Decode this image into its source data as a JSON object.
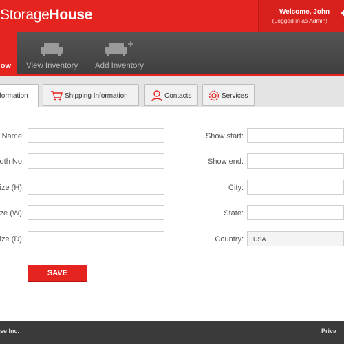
{
  "header": {
    "logo_part1": "Storage",
    "logo_part2": "House",
    "welcome": "Welcome, John",
    "logged_in": "(Logged in as Admin)"
  },
  "nav": {
    "active_label": "ow",
    "items": [
      {
        "label": "View Inventory",
        "icon": "sofa-icon"
      },
      {
        "label": "Add Inventory",
        "icon": "sofa-add-icon"
      }
    ]
  },
  "tabs": [
    {
      "label": "formation",
      "active": true
    },
    {
      "label": "Shipping Information",
      "icon": "cart-icon"
    },
    {
      "label": "Contacts",
      "icon": "person-icon"
    },
    {
      "label": "Services",
      "icon": "gear-icon"
    }
  ],
  "form": {
    "left_fields": [
      {
        "label": "r Name:",
        "value": ""
      },
      {
        "label": "oth No:",
        "value": ""
      },
      {
        "label": "ize (H):",
        "value": ""
      },
      {
        "label": "ize (W):",
        "value": ""
      },
      {
        "label": "ize (D):",
        "value": ""
      }
    ],
    "right_fields": [
      {
        "label": "Show start:",
        "value": ""
      },
      {
        "label": "Show end:",
        "value": ""
      },
      {
        "label": "City:",
        "value": ""
      },
      {
        "label": "State:",
        "value": ""
      }
    ],
    "country_label": "Country:",
    "country_value": "USA",
    "save_label": "SAVE"
  },
  "footer": {
    "left": "se Inc.",
    "right": "Priva"
  },
  "colors": {
    "brand_red": "#e52420",
    "nav_dark": "#4a4a4a",
    "footer_dark": "#3a3a3a"
  }
}
